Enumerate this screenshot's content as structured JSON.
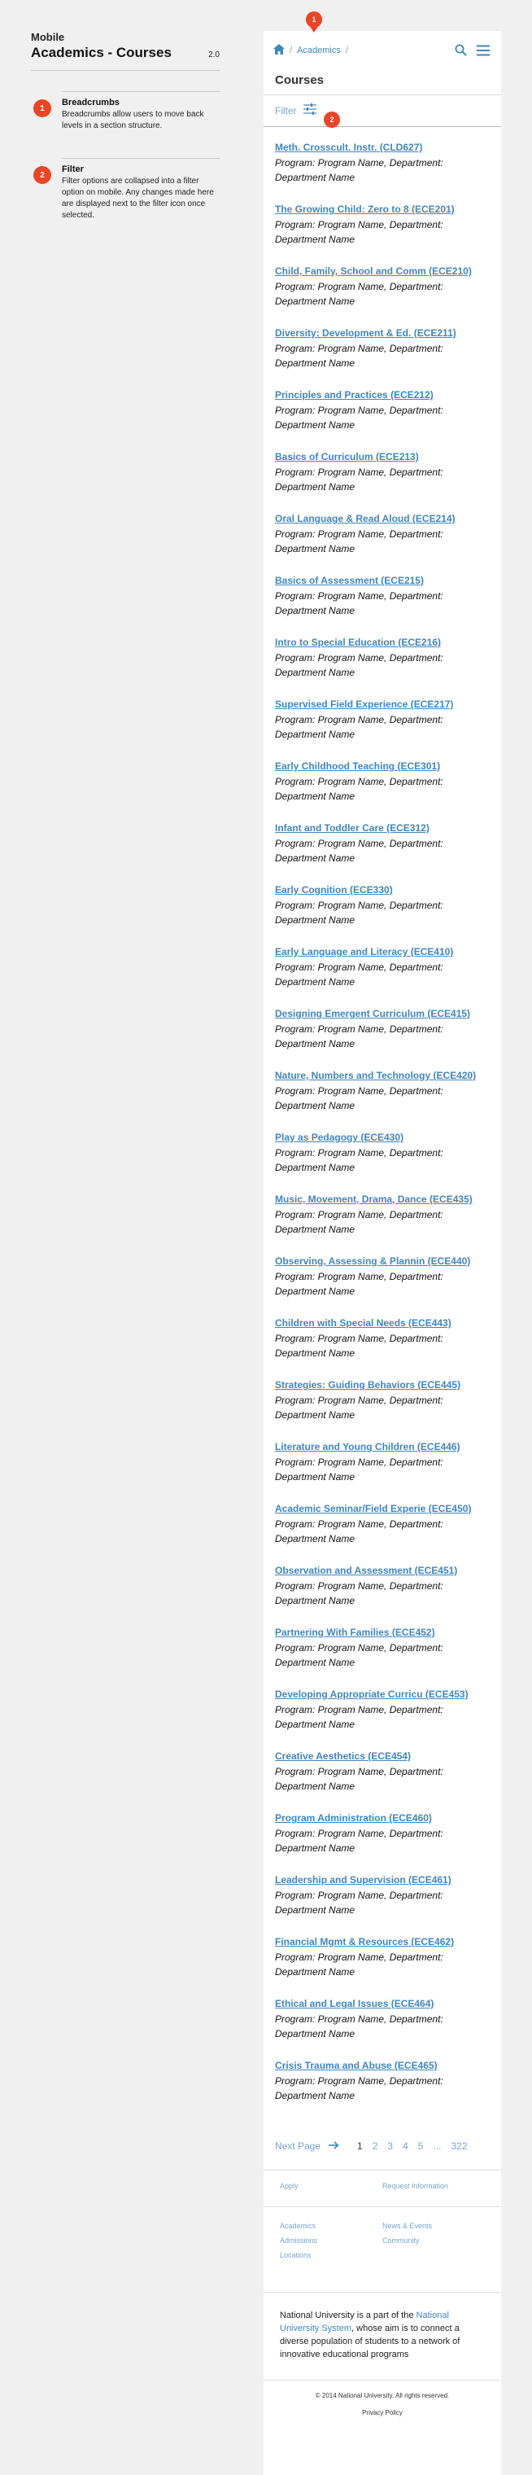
{
  "annotation": {
    "supertitle": "Mobile",
    "title": "Academics - Courses",
    "version": "2.0",
    "notes": [
      {
        "badge": "1",
        "name": "Breadcrumbs",
        "desc": "Breadcrumbs allow users to move back levels in a section structure."
      },
      {
        "badge": "2",
        "name": "Filter",
        "desc": "Filter options are collapsed into a filter option on mobile. Any changes made here are displayed next to the filter icon once selected."
      }
    ]
  },
  "header": {
    "breadcrumb": {
      "sep1": "/",
      "item": "Academics",
      "sep2": "/"
    },
    "pins": {
      "breadcrumb": "1",
      "filter": "2"
    }
  },
  "page_title": "Courses",
  "filter_label": "Filter",
  "meta_text": "Program: Program Name, Department: Department Name",
  "courses": [
    "Meth. Crosscult. Instr. (CLD627)",
    "The Growing Child: Zero to 8 (ECE201)",
    "Child, Family, School and Comm (ECE210)",
    "Diversity: Development & Ed. (ECE211)",
    "Principles and Practices (ECE212)",
    "Basics of Curriculum (ECE213)",
    "Oral Language & Read Aloud (ECE214)",
    "Basics of Assessment (ECE215)",
    "Intro to Special Education (ECE216)",
    "Supervised Field Experience (ECE217)",
    "Early Childhood Teaching (ECE301)",
    "Infant and Toddler Care (ECE312)",
    "Early Cognition (ECE330)",
    "Early Language and Literacy (ECE410)",
    "Designing Emergent Curriculum (ECE415)",
    "Nature, Numbers and Technology (ECE420)",
    "Play as Pedagogy (ECE430)",
    "Music, Movement, Drama, Dance (ECE435)",
    "Observing, Assessing & Plannin (ECE440)",
    "Children with Special Needs (ECE443)",
    "Strategies: Guiding Behaviors (ECE445)",
    "Literature and Young Children (ECE446)",
    "Academic Seminar/Field Experie (ECE450)",
    "Observation and Assessment (ECE451)",
    "Partnering With Families (ECE452)",
    "Developing Appropriate Curricu (ECE453)",
    "Creative Aesthetics (ECE454)",
    "Program Administration (ECE460)",
    "Leadership and Supervision (ECE461)",
    "Financial Mgmt & Resources (ECE462)",
    "Ethical and Legal Issues (ECE464)",
    "Crisis Trauma and Abuse (ECE465)"
  ],
  "pagination": {
    "next_label": "Next Page",
    "pages": [
      "1",
      "2",
      "3",
      "4",
      "5"
    ],
    "ellipsis": "...",
    "last": "322",
    "current": "1"
  },
  "footer": {
    "apply": "Apply",
    "request_info": "Request Information",
    "col1": [
      "Academics",
      "Admissions",
      "Locations"
    ],
    "col2": [
      "News & Events",
      "Community"
    ],
    "about_pre": "National University is a part of the ",
    "about_link": "National University System",
    "about_post": ", whose aim is to connect a diverse population of students to a network of innovative educational programs",
    "copyright": "© 2014 National University. All rights reserved.",
    "privacy": "Privacy Policy"
  },
  "colors": {
    "accent": "#3f86c1",
    "badge": "#ec4424",
    "page_bg": "#f0f0f0"
  }
}
